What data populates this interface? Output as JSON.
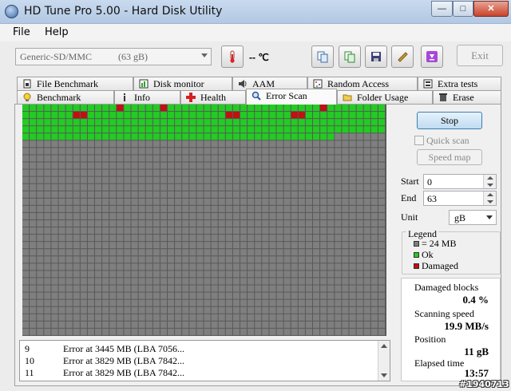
{
  "window": {
    "title": "HD Tune Pro 5.00 - Hard Disk Utility"
  },
  "menu": [
    {
      "label": "File"
    },
    {
      "label": "Help"
    }
  ],
  "toolbar": {
    "drive_name": "Generic-SD/MMC",
    "drive_size": "(63 gB)",
    "temperature": "-- ℃",
    "exit_label": "Exit"
  },
  "tabs_row1": [
    {
      "label": "File Benchmark",
      "icon": "file-benchmark-icon"
    },
    {
      "label": "Disk monitor",
      "icon": "disk-monitor-icon"
    },
    {
      "label": "AAM",
      "icon": "speaker-icon"
    },
    {
      "label": "Random Access",
      "icon": "random-access-icon"
    },
    {
      "label": "Extra tests",
      "icon": "extra-tests-icon"
    }
  ],
  "tabs_row2": [
    {
      "label": "Benchmark",
      "icon": "lightbulb-icon"
    },
    {
      "label": "Info",
      "icon": "info-icon"
    },
    {
      "label": "Health",
      "icon": "health-cross-icon"
    },
    {
      "label": "Error Scan",
      "icon": "magnifier-icon",
      "active": true
    },
    {
      "label": "Folder Usage",
      "icon": "folder-icon"
    },
    {
      "label": "Erase",
      "icon": "trash-icon"
    }
  ],
  "scan": {
    "stop_label": "Stop",
    "quick_scan_label": "Quick scan",
    "quick_scan_checked": false,
    "speed_map_label": "Speed map",
    "start_label": "Start",
    "start_value": "0",
    "end_label": "End",
    "end_value": "63",
    "unit_label": "Unit",
    "unit_value": "gB"
  },
  "legend": {
    "title": "Legend",
    "items": [
      {
        "label": "= 24 MB",
        "color": "#7f7f7f"
      },
      {
        "label": "Ok",
        "color": "#22cc22"
      },
      {
        "label": "Damaged",
        "color": "#c01010"
      }
    ]
  },
  "stats": {
    "damaged_blocks_label": "Damaged blocks",
    "damaged_blocks_value": "0.4 %",
    "scanning_speed_label": "Scanning speed",
    "scanning_speed_value": "19.9 MB/s",
    "position_label": "Position",
    "position_value": "11 gB",
    "elapsed_label": "Elapsed time",
    "elapsed_value": "13:57"
  },
  "log": [
    {
      "num": "9",
      "message": "Error at 3445 MB (LBA 7056..."
    },
    {
      "num": "10",
      "message": "Error at 3829 MB (LBA 7842..."
    },
    {
      "num": "11",
      "message": "Error at 3829 MB (LBA 7842..."
    }
  ],
  "watermark": "#1940713",
  "colors": {
    "block_ok": "#22cc22",
    "block_pending": "#7f7f7f",
    "block_damaged": "#c01010",
    "grid_line": "#4a4a4a"
  }
}
